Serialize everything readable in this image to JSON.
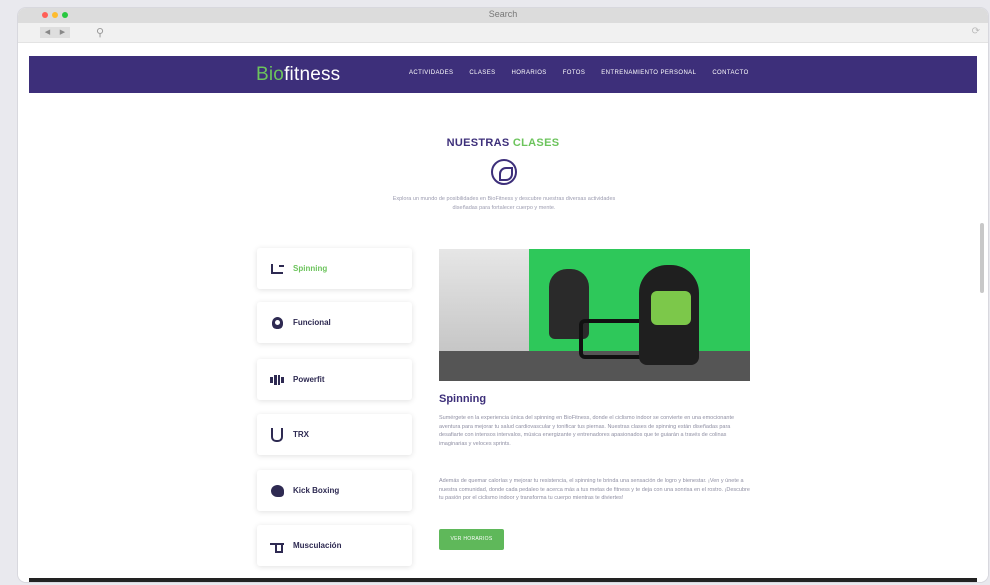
{
  "browser": {
    "title": "Search",
    "back_icon": "chevron-left-icon",
    "forward_icon": "chevron-right-icon",
    "traffic_lights": [
      "#ff5f57",
      "#febc2e",
      "#28c840"
    ]
  },
  "site": {
    "logo_prefix": "Bio",
    "logo_suffix": "fitness",
    "menu": [
      "ACTIVIDADES",
      "CLASES",
      "HORARIOS",
      "FOTOS",
      "ENTRENAMIENTO PERSONAL",
      "CONTACTO"
    ],
    "brand_color": "#3d2f7a",
    "accent_color": "#6cc45c"
  },
  "section": {
    "title_main": "NUESTRAS",
    "title_accent": "CLASES",
    "intro": "Explora un mundo de posibilidades en BioFitness y descubre nuestras diversas actividades diseñadas para fortalecer cuerpo y mente."
  },
  "classes": [
    {
      "label": "Spinning",
      "icon": "bike-icon",
      "active": true
    },
    {
      "label": "Funcional",
      "icon": "kettlebell-icon",
      "active": false
    },
    {
      "label": "Powerfit",
      "icon": "dumbbell-icon",
      "active": false
    },
    {
      "label": "TRX",
      "icon": "trx-straps-icon",
      "active": false
    },
    {
      "label": "Kick Boxing",
      "icon": "boxing-glove-icon",
      "active": false
    },
    {
      "label": "Musculación",
      "icon": "barbell-icon",
      "active": false
    }
  ],
  "content": {
    "title": "Spinning",
    "para1": "Sumérgete en la experiencia única del spinning en BioFitness, donde el ciclismo indoor se convierte en una emocionante aventura para mejorar tu salud cardiovascular y tonificar tus piernas. Nuestras clases de spinning están diseñadas para desafiarte con intensos intervalos, música energizante y entrenadores apasionados que te guiarán a través de colinas imaginarias y veloces sprints.",
    "para2": "Además de quemar calorías y mejorar tu resistencia, el spinning te brinda una sensación de logro y bienestar. ¡Ven y únete a nuestra comunidad, donde cada pedaleo te acerca más a tus metas de fitness y te deja con una sonrisa en el rostro. ¡Descubre tu pasión por el ciclismo indoor y transforma tu cuerpo mientras te diviertes!",
    "button": "VER HORARIOS"
  }
}
